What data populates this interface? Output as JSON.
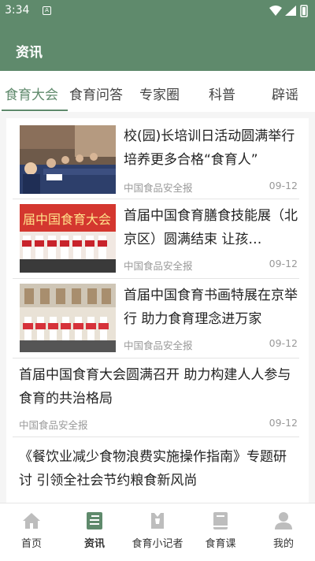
{
  "status": {
    "time": "3:34",
    "a_badge": "A"
  },
  "appbar": {
    "title": "资讯"
  },
  "tabs": [
    {
      "label": "食育大会"
    },
    {
      "label": "食育问答"
    },
    {
      "label": "专家圈"
    },
    {
      "label": "科普"
    },
    {
      "label": "辟谣"
    }
  ],
  "articles": [
    {
      "title": "校(园)长培训日活动圆满举行培养更多合格“食育人”",
      "source": "中国食品安全报",
      "date": "09-12"
    },
    {
      "title": "首届中国食育膳食技能展（北京区）圆满结束 让孩…",
      "source": "中国食品安全报",
      "date": "09-12"
    },
    {
      "title": "首届中国食育书画特展在京举行 助力食育理念进万家",
      "source": "中国食品安全报",
      "date": "09-12"
    },
    {
      "title": "首届中国食育大会圆满召开 助力构建人人参与食育的共治格局",
      "source": "中国食品安全报",
      "date": "09-12"
    },
    {
      "title": "《餐饮业减少食物浪费实施操作指南》专题研讨 引领全社会节约粮食新风尚",
      "source": "",
      "date": ""
    }
  ],
  "image_text": {
    "banner": "届中国食育大会"
  },
  "bottom_nav": [
    {
      "label": "首页",
      "icon": "home-icon"
    },
    {
      "label": "资讯",
      "icon": "news-icon"
    },
    {
      "label": "食育小记者",
      "icon": "reporter-icon"
    },
    {
      "label": "食育课",
      "icon": "book-icon"
    },
    {
      "label": "我的",
      "icon": "person-icon"
    }
  ],
  "colors": {
    "brand": "#5f8a6c",
    "muted": "#999999",
    "nav_icon": "#bdbdbd"
  }
}
